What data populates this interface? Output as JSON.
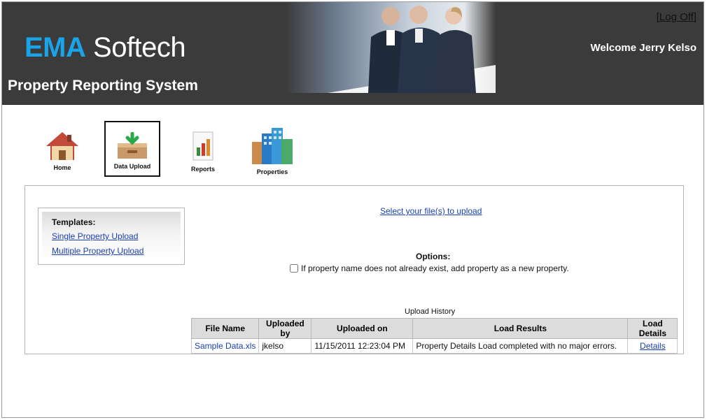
{
  "header": {
    "brand_part1": "EMA",
    "brand_part2": "Softech",
    "system_title": "Property Reporting System",
    "logoff": "[Log Off]",
    "welcome": "Welcome Jerry Kelso"
  },
  "nav": {
    "items": [
      {
        "label": "Home",
        "icon": "house-icon"
      },
      {
        "label": "Data Upload",
        "icon": "upload-tray-icon",
        "active": true
      },
      {
        "label": "Reports",
        "icon": "report-chart-icon"
      },
      {
        "label": "Properties",
        "icon": "buildings-icon"
      }
    ]
  },
  "templates": {
    "title": "Templates:",
    "links": [
      "Single Property Upload",
      "Multiple Property Upload"
    ]
  },
  "upload": {
    "select_files": "Select your file(s) to upload",
    "options_label": "Options:",
    "option_text": "If property name does not already exist, add property as a new property."
  },
  "history": {
    "caption": "Upload History",
    "headers": [
      "File Name",
      "Uploaded by",
      "Uploaded on",
      "Load Results",
      "Load Details"
    ],
    "rows": [
      {
        "file_name": "Sample Data.xls",
        "uploaded_by": "jkelso",
        "uploaded_on": "11/15/2011 12:23:04 PM",
        "load_results": "Property Details Load completed with no major errors.",
        "load_details": "Details"
      }
    ]
  },
  "colors": {
    "header_bg": "#3b3b3b",
    "brand_accent": "#1aa3e8",
    "link": "#1a3fb0"
  }
}
